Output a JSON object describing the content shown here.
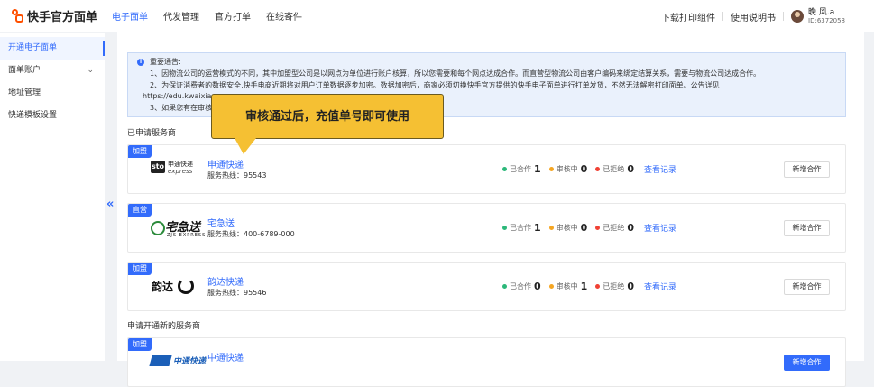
{
  "app": {
    "logo_text": "快手官方面单",
    "nav": [
      "电子面单",
      "代发管理",
      "官方打单",
      "在线寄件"
    ],
    "top_links": [
      "下载打印组件",
      "使用说明书"
    ],
    "user": {
      "name": "晚 风.a",
      "id": "ID:6372058"
    }
  },
  "sidebar": {
    "items": [
      "开通电子面单",
      "面单账户",
      "地址管理",
      "快递模板设置"
    ]
  },
  "notice": {
    "title": "重要通告:",
    "lines": [
      "1、因物流公司的运营模式的不同，其中加盟型公司是以网点为单位进行账户核算，所以您需要和每个网点达成合作。而直营型物流公司由客户编码来绑定结算关系，需要与物流公司达成合作。",
      "2、为保证消费者的数据安全,快手电商近期将对用户订单数据逐步加密。数据加密后，商家必须切换快手官方提供的快手电子面单进行打单发货，不然无法解密打印面单。公告详见",
      "https://edu.kwaixiao",
      "3、如果您有在审核"
    ]
  },
  "tooltip": "审核通过后，充值单号即可使用",
  "sections": {
    "applied": "已申请服务商",
    "new": "申请开通新的服务商"
  },
  "labels": {
    "cooperating": "已合作",
    "reviewing": "审核中",
    "rejected": "已拒绝",
    "record": "查看记录",
    "add": "新增合作"
  },
  "colors": {
    "cooperating": "#2cb87a",
    "reviewing": "#f5a623",
    "rejected": "#f04134",
    "accent": "#326bfb"
  },
  "providers": [
    {
      "tag": "加盟",
      "name": "申通快递",
      "hotline": "服务热线：95543",
      "logo": "sto-logo",
      "logo_text": "申通快递",
      "logo_sub": "express",
      "cooperating": "1",
      "reviewing": "0",
      "rejected": "0"
    },
    {
      "tag": "直营",
      "name": "宅急送",
      "hotline": "服务热线：400-6789-000",
      "logo": "zjs-logo",
      "logo_text": "宅急送",
      "logo_sub": "ZJS EXPRESS",
      "cooperating": "1",
      "reviewing": "0",
      "rejected": "0"
    },
    {
      "tag": "加盟",
      "name": "韵达快递",
      "hotline": "服务热线：95546",
      "logo": "yunda-logo",
      "logo_text": "韵达",
      "cooperating": "0",
      "reviewing": "1",
      "rejected": "0"
    }
  ],
  "new_providers": [
    {
      "tag": "加盟",
      "name": "中通快递",
      "logo": "zto-logo",
      "logo_text": "中通快递"
    }
  ]
}
